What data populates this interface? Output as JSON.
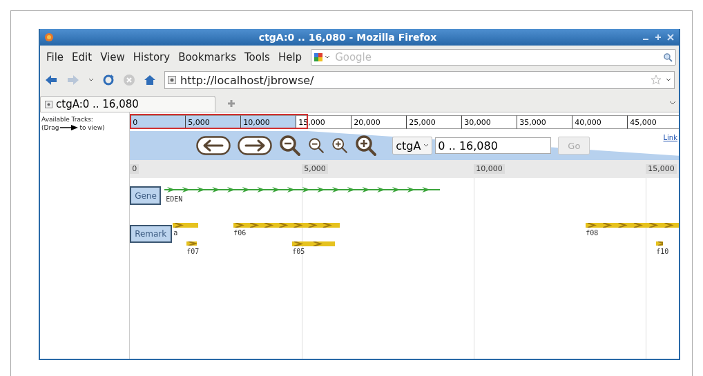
{
  "window": {
    "title": "ctgA:0 .. 16,080 - Mozilla Firefox"
  },
  "menu": [
    "File",
    "Edit",
    "View",
    "History",
    "Bookmarks",
    "Tools",
    "Help"
  ],
  "search": {
    "placeholder": "Google"
  },
  "address": {
    "value": "http://localhost/jbrowse/"
  },
  "tabs": [
    {
      "label": "ctgA:0 .. 16,080",
      "selected": true
    }
  ],
  "sidebar": {
    "title": "Available Tracks:",
    "hint_before": "(Drag",
    "hint_after": "to view)"
  },
  "overview": {
    "ticks": [
      "0",
      "5,000",
      "10,000",
      "15,000",
      "20,000",
      "25,000",
      "30,000",
      "35,000",
      "40,000",
      "45,000"
    ]
  },
  "navigation": {
    "reference": "ctgA",
    "location": "0 .. 16,080",
    "go": "Go",
    "link": "Link"
  },
  "ruler": {
    "ticks": [
      "0",
      "5,000",
      "10,000",
      "15,000"
    ]
  },
  "tracks": [
    {
      "label": "Gene",
      "kind": "gene",
      "features": [
        {
          "label": "EDEN"
        }
      ]
    },
    {
      "label": "Remark",
      "kind": "remark",
      "features": [
        {
          "label": "a"
        },
        {
          "label": "f06"
        },
        {
          "label": "f07"
        },
        {
          "label": "f05"
        },
        {
          "label": "f08"
        },
        {
          "label": "f10"
        }
      ]
    }
  ]
}
